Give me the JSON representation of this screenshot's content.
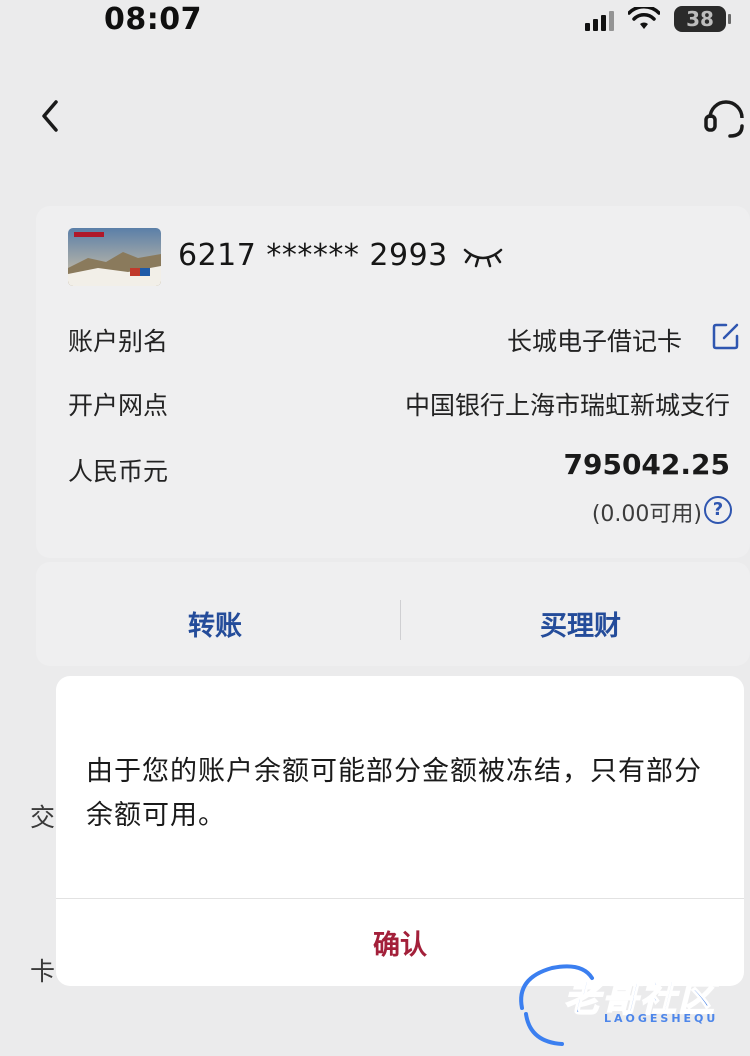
{
  "status_bar": {
    "time": "08:07",
    "battery": "38"
  },
  "header": {
    "back_icon": "chevron-left-icon",
    "service_icon": "headset-icon"
  },
  "account_card": {
    "card_number": "6217 ****** 2993",
    "rows": [
      {
        "label": "账户别名",
        "value": "长城电子借记卡"
      },
      {
        "label": "开户网点",
        "value": "中国银行上海市瑞虹新城支行"
      },
      {
        "label": "人民币元",
        "value": "795042.25"
      }
    ],
    "available": "(0.00可用)",
    "help_glyph": "?"
  },
  "actions": {
    "transfer": "转账",
    "buy_wealth": "买理财"
  },
  "background": {
    "left_fragment_1": "交",
    "left_fragment_2": "卡"
  },
  "dialog": {
    "message": "由于您的账户余额可能部分金额被冻结，只有部分余额可用。",
    "confirm": "确认"
  },
  "watermark": {
    "title": "老哥社区",
    "subtitle": "LAOGESHEQU"
  },
  "colors": {
    "accent_blue": "#244c9a",
    "confirm_red": "#a3203a",
    "background": "#ebebec"
  }
}
